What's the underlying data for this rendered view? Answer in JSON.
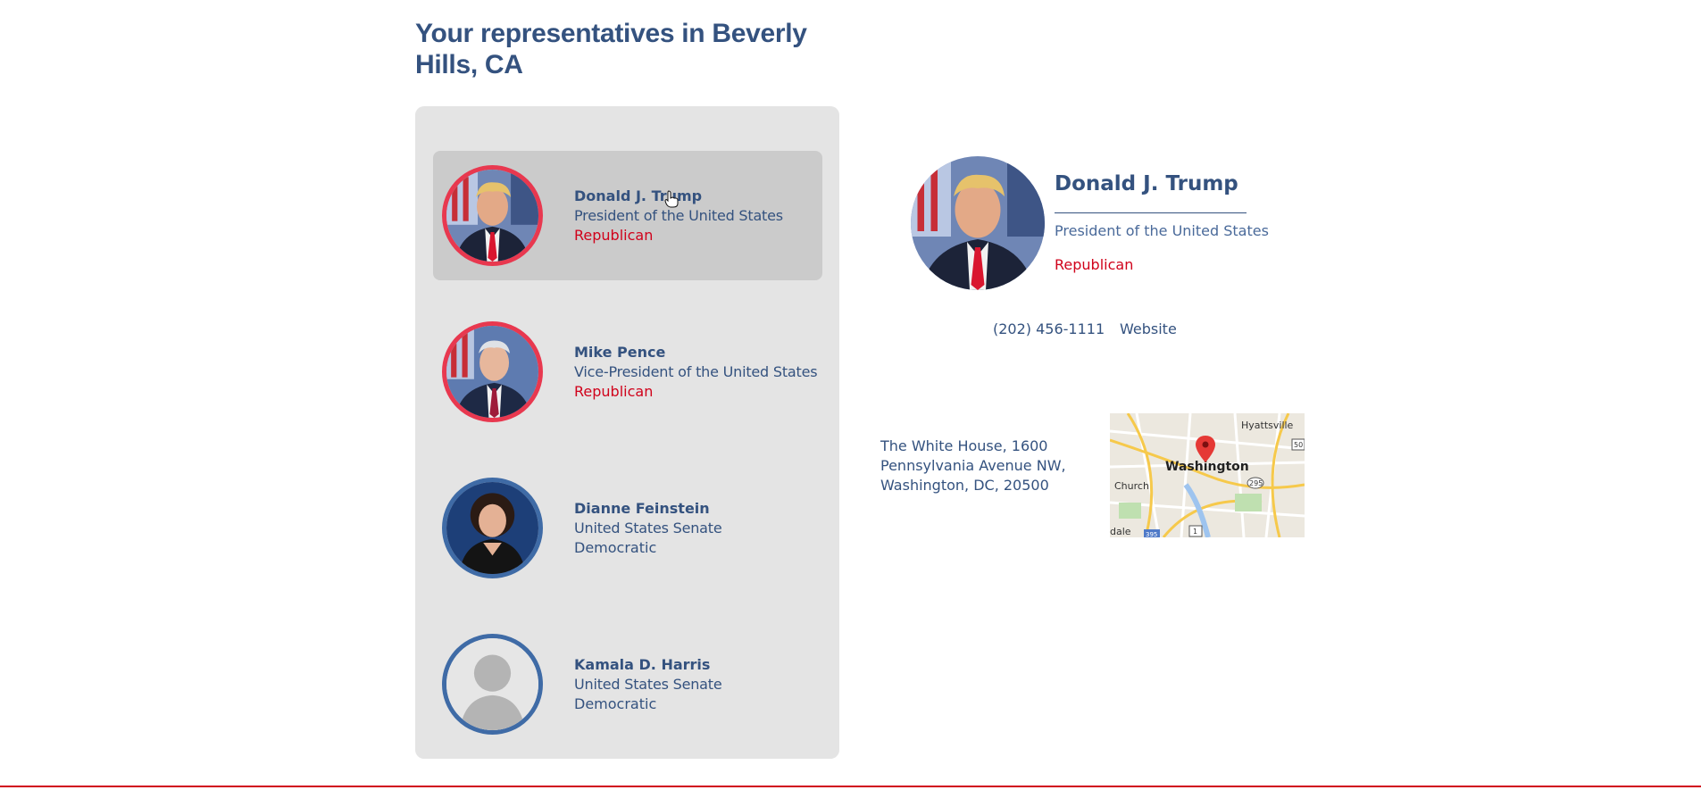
{
  "page": {
    "title": "Your representatives in Beverly Hills, CA"
  },
  "representatives": [
    {
      "name": "Donald J. Trump",
      "office": "President of the United States",
      "party": "Republican",
      "photo": "trump-photo",
      "selected": true
    },
    {
      "name": "Mike Pence",
      "office": "Vice-President of the United States",
      "party": "Republican",
      "photo": "pence-photo",
      "selected": false
    },
    {
      "name": "Dianne Feinstein",
      "office": "United States Senate",
      "party": "Democratic",
      "photo": "feinstein-photo",
      "selected": false
    },
    {
      "name": "Kamala D. Harris",
      "office": "United States Senate",
      "party": "Democratic",
      "photo": "placeholder-person-icon",
      "selected": false
    }
  ],
  "detail": {
    "name": "Donald J. Trump",
    "office": "President of the United States",
    "party": "Republican",
    "phone": "(202) 456-1111",
    "website_label": "Website",
    "address": "The White House, 1600 Pennsylvania Avenue NW, Washington, DC, 20500",
    "map": {
      "city_label": "Washington",
      "labels": [
        "Hyattsville",
        "Church",
        "dale"
      ],
      "route_shields": [
        "295",
        "50",
        "1",
        "395"
      ]
    }
  },
  "colors": {
    "navy": "#34527f",
    "republican": "#d0021b",
    "republican_ring": "#e8384f",
    "democratic_ring": "#3f6ba6",
    "panel_bg": "#e4e4e4",
    "selected_bg": "#cbcbcb"
  }
}
